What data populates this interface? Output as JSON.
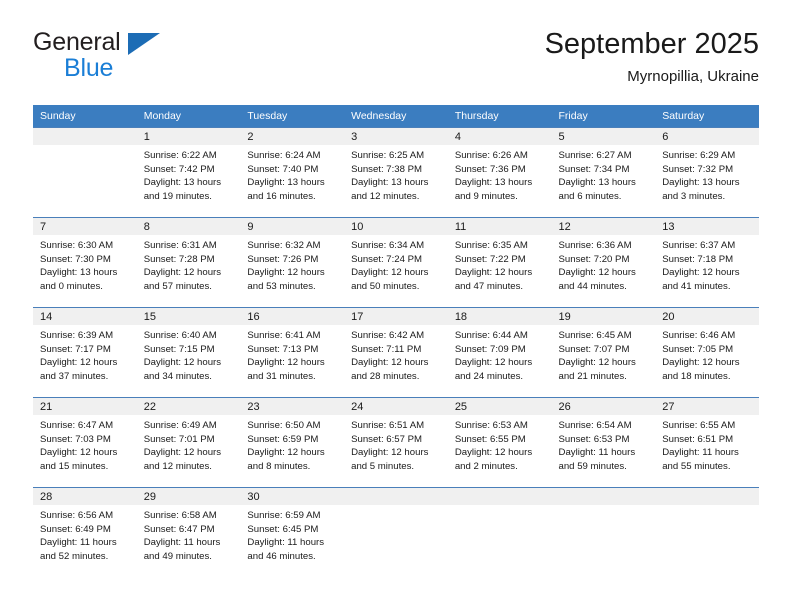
{
  "brand": {
    "line1": "General",
    "line2": "Blue",
    "triangle_color": "#1c6cb5",
    "line2_color": "#1a7ed6"
  },
  "header": {
    "title": "September 2025",
    "subtitle": "Myrnopillia, Ukraine"
  },
  "theme": {
    "header_row_bg": "#3b7dc0",
    "date_band_bg": "#f0f0f0",
    "grid_line": "#4a7fba",
    "text": "#1a1a1a"
  },
  "weekday_headers": [
    "Sunday",
    "Monday",
    "Tuesday",
    "Wednesday",
    "Thursday",
    "Friday",
    "Saturday"
  ],
  "weeks": [
    [
      {
        "date": "",
        "sunrise": "",
        "sunset": "",
        "daylight_line1": "",
        "daylight_line2": "",
        "empty": true
      },
      {
        "date": "1",
        "sunrise": "Sunrise: 6:22 AM",
        "sunset": "Sunset: 7:42 PM",
        "daylight_line1": "Daylight: 13 hours",
        "daylight_line2": "and 19 minutes."
      },
      {
        "date": "2",
        "sunrise": "Sunrise: 6:24 AM",
        "sunset": "Sunset: 7:40 PM",
        "daylight_line1": "Daylight: 13 hours",
        "daylight_line2": "and 16 minutes."
      },
      {
        "date": "3",
        "sunrise": "Sunrise: 6:25 AM",
        "sunset": "Sunset: 7:38 PM",
        "daylight_line1": "Daylight: 13 hours",
        "daylight_line2": "and 12 minutes."
      },
      {
        "date": "4",
        "sunrise": "Sunrise: 6:26 AM",
        "sunset": "Sunset: 7:36 PM",
        "daylight_line1": "Daylight: 13 hours",
        "daylight_line2": "and 9 minutes."
      },
      {
        "date": "5",
        "sunrise": "Sunrise: 6:27 AM",
        "sunset": "Sunset: 7:34 PM",
        "daylight_line1": "Daylight: 13 hours",
        "daylight_line2": "and 6 minutes."
      },
      {
        "date": "6",
        "sunrise": "Sunrise: 6:29 AM",
        "sunset": "Sunset: 7:32 PM",
        "daylight_line1": "Daylight: 13 hours",
        "daylight_line2": "and 3 minutes."
      }
    ],
    [
      {
        "date": "7",
        "sunrise": "Sunrise: 6:30 AM",
        "sunset": "Sunset: 7:30 PM",
        "daylight_line1": "Daylight: 13 hours",
        "daylight_line2": "and 0 minutes."
      },
      {
        "date": "8",
        "sunrise": "Sunrise: 6:31 AM",
        "sunset": "Sunset: 7:28 PM",
        "daylight_line1": "Daylight: 12 hours",
        "daylight_line2": "and 57 minutes."
      },
      {
        "date": "9",
        "sunrise": "Sunrise: 6:32 AM",
        "sunset": "Sunset: 7:26 PM",
        "daylight_line1": "Daylight: 12 hours",
        "daylight_line2": "and 53 minutes."
      },
      {
        "date": "10",
        "sunrise": "Sunrise: 6:34 AM",
        "sunset": "Sunset: 7:24 PM",
        "daylight_line1": "Daylight: 12 hours",
        "daylight_line2": "and 50 minutes."
      },
      {
        "date": "11",
        "sunrise": "Sunrise: 6:35 AM",
        "sunset": "Sunset: 7:22 PM",
        "daylight_line1": "Daylight: 12 hours",
        "daylight_line2": "and 47 minutes."
      },
      {
        "date": "12",
        "sunrise": "Sunrise: 6:36 AM",
        "sunset": "Sunset: 7:20 PM",
        "daylight_line1": "Daylight: 12 hours",
        "daylight_line2": "and 44 minutes."
      },
      {
        "date": "13",
        "sunrise": "Sunrise: 6:37 AM",
        "sunset": "Sunset: 7:18 PM",
        "daylight_line1": "Daylight: 12 hours",
        "daylight_line2": "and 41 minutes."
      }
    ],
    [
      {
        "date": "14",
        "sunrise": "Sunrise: 6:39 AM",
        "sunset": "Sunset: 7:17 PM",
        "daylight_line1": "Daylight: 12 hours",
        "daylight_line2": "and 37 minutes."
      },
      {
        "date": "15",
        "sunrise": "Sunrise: 6:40 AM",
        "sunset": "Sunset: 7:15 PM",
        "daylight_line1": "Daylight: 12 hours",
        "daylight_line2": "and 34 minutes."
      },
      {
        "date": "16",
        "sunrise": "Sunrise: 6:41 AM",
        "sunset": "Sunset: 7:13 PM",
        "daylight_line1": "Daylight: 12 hours",
        "daylight_line2": "and 31 minutes."
      },
      {
        "date": "17",
        "sunrise": "Sunrise: 6:42 AM",
        "sunset": "Sunset: 7:11 PM",
        "daylight_line1": "Daylight: 12 hours",
        "daylight_line2": "and 28 minutes."
      },
      {
        "date": "18",
        "sunrise": "Sunrise: 6:44 AM",
        "sunset": "Sunset: 7:09 PM",
        "daylight_line1": "Daylight: 12 hours",
        "daylight_line2": "and 24 minutes."
      },
      {
        "date": "19",
        "sunrise": "Sunrise: 6:45 AM",
        "sunset": "Sunset: 7:07 PM",
        "daylight_line1": "Daylight: 12 hours",
        "daylight_line2": "and 21 minutes."
      },
      {
        "date": "20",
        "sunrise": "Sunrise: 6:46 AM",
        "sunset": "Sunset: 7:05 PM",
        "daylight_line1": "Daylight: 12 hours",
        "daylight_line2": "and 18 minutes."
      }
    ],
    [
      {
        "date": "21",
        "sunrise": "Sunrise: 6:47 AM",
        "sunset": "Sunset: 7:03 PM",
        "daylight_line1": "Daylight: 12 hours",
        "daylight_line2": "and 15 minutes."
      },
      {
        "date": "22",
        "sunrise": "Sunrise: 6:49 AM",
        "sunset": "Sunset: 7:01 PM",
        "daylight_line1": "Daylight: 12 hours",
        "daylight_line2": "and 12 minutes."
      },
      {
        "date": "23",
        "sunrise": "Sunrise: 6:50 AM",
        "sunset": "Sunset: 6:59 PM",
        "daylight_line1": "Daylight: 12 hours",
        "daylight_line2": "and 8 minutes."
      },
      {
        "date": "24",
        "sunrise": "Sunrise: 6:51 AM",
        "sunset": "Sunset: 6:57 PM",
        "daylight_line1": "Daylight: 12 hours",
        "daylight_line2": "and 5 minutes."
      },
      {
        "date": "25",
        "sunrise": "Sunrise: 6:53 AM",
        "sunset": "Sunset: 6:55 PM",
        "daylight_line1": "Daylight: 12 hours",
        "daylight_line2": "and 2 minutes."
      },
      {
        "date": "26",
        "sunrise": "Sunrise: 6:54 AM",
        "sunset": "Sunset: 6:53 PM",
        "daylight_line1": "Daylight: 11 hours",
        "daylight_line2": "and 59 minutes."
      },
      {
        "date": "27",
        "sunrise": "Sunrise: 6:55 AM",
        "sunset": "Sunset: 6:51 PM",
        "daylight_line1": "Daylight: 11 hours",
        "daylight_line2": "and 55 minutes."
      }
    ],
    [
      {
        "date": "28",
        "sunrise": "Sunrise: 6:56 AM",
        "sunset": "Sunset: 6:49 PM",
        "daylight_line1": "Daylight: 11 hours",
        "daylight_line2": "and 52 minutes."
      },
      {
        "date": "29",
        "sunrise": "Sunrise: 6:58 AM",
        "sunset": "Sunset: 6:47 PM",
        "daylight_line1": "Daylight: 11 hours",
        "daylight_line2": "and 49 minutes."
      },
      {
        "date": "30",
        "sunrise": "Sunrise: 6:59 AM",
        "sunset": "Sunset: 6:45 PM",
        "daylight_line1": "Daylight: 11 hours",
        "daylight_line2": "and 46 minutes."
      },
      {
        "date": "",
        "sunrise": "",
        "sunset": "",
        "daylight_line1": "",
        "daylight_line2": "",
        "empty": true
      },
      {
        "date": "",
        "sunrise": "",
        "sunset": "",
        "daylight_line1": "",
        "daylight_line2": "",
        "empty": true
      },
      {
        "date": "",
        "sunrise": "",
        "sunset": "",
        "daylight_line1": "",
        "daylight_line2": "",
        "empty": true
      },
      {
        "date": "",
        "sunrise": "",
        "sunset": "",
        "daylight_line1": "",
        "daylight_line2": "",
        "empty": true
      }
    ]
  ]
}
